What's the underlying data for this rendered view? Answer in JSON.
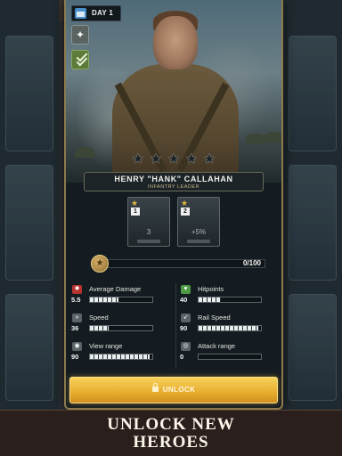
{
  "header": {
    "day_label": "DAY 1"
  },
  "hero": {
    "name": "HENRY \"HANK\" CALLAHAN",
    "role": "INFANTRY LEADER",
    "stars_total": 5,
    "stars_filled": 0
  },
  "skills": [
    {
      "level": "1",
      "value": "3"
    },
    {
      "level": "2",
      "value": "+5%"
    }
  ],
  "progress": {
    "text": "0/100",
    "fraction": 0
  },
  "stats": [
    {
      "label": "Average Damage",
      "value": "5.5",
      "fill": 0.45,
      "icon": "damage-icon",
      "icon_color": "#b8332f"
    },
    {
      "label": "Hitpoints",
      "value": "40",
      "fill": 0.35,
      "icon": "heart-icon",
      "icon_color": "#4e9a45"
    },
    {
      "label": "Speed",
      "value": "36",
      "fill": 0.3,
      "icon": "speed-icon",
      "icon_color": "#5b6368"
    },
    {
      "label": "Rail Speed",
      "value": "90",
      "fill": 0.95,
      "icon": "rail-speed-icon",
      "icon_color": "#5b6368"
    },
    {
      "label": "View range",
      "value": "90",
      "fill": 0.95,
      "icon": "view-range-icon",
      "icon_color": "#5b6368"
    },
    {
      "label": "Attack range",
      "value": "0",
      "fill": 0.0,
      "icon": "attack-range-icon",
      "icon_color": "#5b6368"
    }
  ],
  "unlock_button": {
    "label": "UNLOCK"
  },
  "footer": {
    "line1": "UNLOCK NEW",
    "line2": "HEROES"
  },
  "colors": {
    "accent_gold": "#e6ad2e",
    "card_border": "#8c7a4c",
    "skill_star": "#e3b541"
  }
}
